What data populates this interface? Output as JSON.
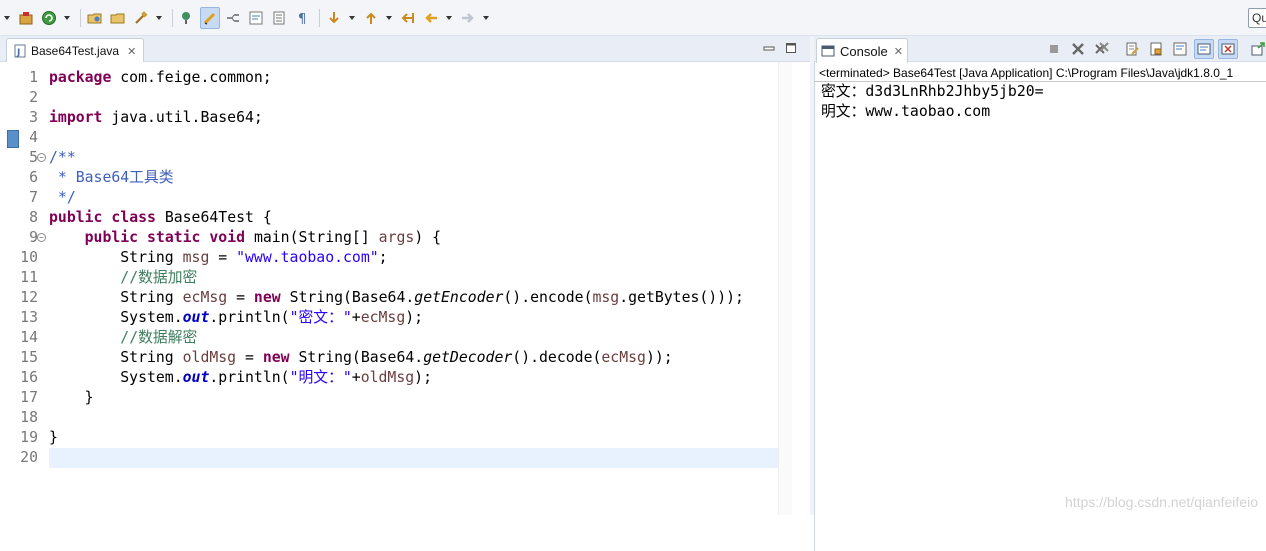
{
  "toolbar": {
    "quick_access_text": "Qu",
    "icons": [
      "external-tools-icon",
      "run-icon",
      "open-type-icon",
      "open-resource-icon",
      "build-icon",
      "next-annotation-icon",
      "mark-occurrences-icon",
      "toggle-breadcrumb-icon",
      "word-wrap-icon",
      "block-select-icon",
      "show-whitespace-icon",
      "next-edit-icon",
      "prev-edit-icon",
      "back-icon",
      "forward-icon"
    ]
  },
  "editor": {
    "tab_label": "Base64Test.java",
    "lines": [
      {
        "n": "1",
        "tokens": [
          {
            "c": "kw",
            "t": "package"
          },
          {
            "c": "",
            "t": " com.feige.common;"
          }
        ]
      },
      {
        "n": "2",
        "tokens": []
      },
      {
        "n": "3",
        "tokens": [
          {
            "c": "kw",
            "t": "import"
          },
          {
            "c": "",
            "t": " java.util.Base64;"
          }
        ]
      },
      {
        "n": "4",
        "tokens": []
      },
      {
        "n": "5",
        "fold": "⊖",
        "tokens": [
          {
            "c": "jd",
            "t": "/**"
          }
        ]
      },
      {
        "n": "6",
        "tokens": [
          {
            "c": "jd",
            "t": " * Base64工具类"
          }
        ]
      },
      {
        "n": "7",
        "tokens": [
          {
            "c": "jd",
            "t": " */"
          }
        ]
      },
      {
        "n": "8",
        "tokens": [
          {
            "c": "kw",
            "t": "public"
          },
          {
            "c": "",
            "t": " "
          },
          {
            "c": "kw",
            "t": "class"
          },
          {
            "c": "",
            "t": " Base64Test {"
          }
        ]
      },
      {
        "n": "9",
        "fold": "⊖",
        "tokens": [
          {
            "c": "",
            "t": "    "
          },
          {
            "c": "kw",
            "t": "public"
          },
          {
            "c": "",
            "t": " "
          },
          {
            "c": "kw",
            "t": "static"
          },
          {
            "c": "",
            "t": " "
          },
          {
            "c": "kw",
            "t": "void"
          },
          {
            "c": "",
            "t": " main(String[] "
          },
          {
            "c": "var",
            "t": "args"
          },
          {
            "c": "",
            "t": ") {"
          }
        ]
      },
      {
        "n": "10",
        "tokens": [
          {
            "c": "",
            "t": "        String "
          },
          {
            "c": "var",
            "t": "msg"
          },
          {
            "c": "",
            "t": " = "
          },
          {
            "c": "str",
            "t": "\"www.taobao.com\""
          },
          {
            "c": "",
            "t": ";"
          }
        ]
      },
      {
        "n": "11",
        "tokens": [
          {
            "c": "",
            "t": "        "
          },
          {
            "c": "cm",
            "t": "//数据加密"
          }
        ]
      },
      {
        "n": "12",
        "tokens": [
          {
            "c": "",
            "t": "        String "
          },
          {
            "c": "var",
            "t": "ecMsg"
          },
          {
            "c": "",
            "t": " = "
          },
          {
            "c": "kw",
            "t": "new"
          },
          {
            "c": "",
            "t": " String(Base64."
          },
          {
            "c": "st",
            "t": "getEncoder"
          },
          {
            "c": "",
            "t": "().encode("
          },
          {
            "c": "var",
            "t": "msg"
          },
          {
            "c": "",
            "t": ".getBytes()));"
          }
        ]
      },
      {
        "n": "13",
        "tokens": [
          {
            "c": "",
            "t": "        System."
          },
          {
            "c": "fld",
            "t": "out"
          },
          {
            "c": "",
            "t": ".println("
          },
          {
            "c": "str",
            "t": "\"密文：\""
          },
          {
            "c": "",
            "t": "+"
          },
          {
            "c": "var",
            "t": "ecMsg"
          },
          {
            "c": "",
            "t": ");"
          }
        ]
      },
      {
        "n": "14",
        "tokens": [
          {
            "c": "",
            "t": "        "
          },
          {
            "c": "cm",
            "t": "//数据解密"
          }
        ]
      },
      {
        "n": "15",
        "tokens": [
          {
            "c": "",
            "t": "        String "
          },
          {
            "c": "var",
            "t": "oldMsg"
          },
          {
            "c": "",
            "t": " = "
          },
          {
            "c": "kw",
            "t": "new"
          },
          {
            "c": "",
            "t": " String(Base64."
          },
          {
            "c": "st",
            "t": "getDecoder"
          },
          {
            "c": "",
            "t": "().decode("
          },
          {
            "c": "var",
            "t": "ecMsg"
          },
          {
            "c": "",
            "t": "));"
          }
        ]
      },
      {
        "n": "16",
        "tokens": [
          {
            "c": "",
            "t": "        System."
          },
          {
            "c": "fld",
            "t": "out"
          },
          {
            "c": "",
            "t": ".println("
          },
          {
            "c": "str",
            "t": "\"明文：\""
          },
          {
            "c": "",
            "t": "+"
          },
          {
            "c": "var",
            "t": "oldMsg"
          },
          {
            "c": "",
            "t": ");"
          }
        ]
      },
      {
        "n": "17",
        "tokens": [
          {
            "c": "",
            "t": "    }"
          }
        ]
      },
      {
        "n": "18",
        "tokens": []
      },
      {
        "n": "19",
        "tokens": [
          {
            "c": "",
            "t": "}"
          }
        ]
      },
      {
        "n": "20",
        "current": true,
        "tokens": []
      }
    ]
  },
  "console": {
    "tab_label": "Console",
    "status": "<terminated> Base64Test [Java Application] C:\\Program Files\\Java\\jdk1.8.0_1",
    "output": [
      "密文：d3d3LnRhb2Jhby5jb20=",
      "明文：www.taobao.com"
    ],
    "tool_icons": [
      "terminate-icon",
      "remove-launch-icon",
      "remove-all-terminated-icon",
      "clear-console-icon",
      "scroll-lock-icon",
      "word-wrap-icon",
      "show-on-stdout-icon",
      "show-on-stderr-icon",
      "pin-console-icon"
    ]
  },
  "watermark": "https://blog.csdn.net/qianfeifeio"
}
